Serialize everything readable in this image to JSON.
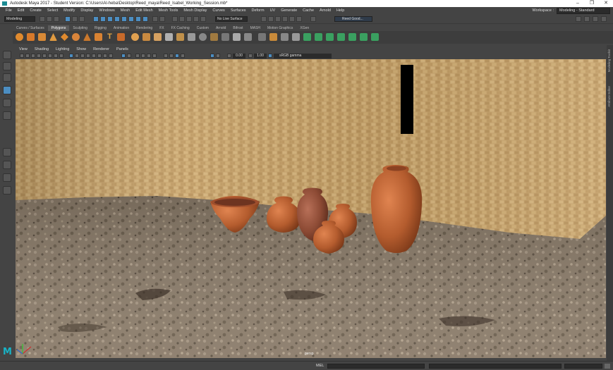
{
  "window": {
    "title": "Autodesk Maya 2017 - Student Version: C:\\Users\\Al-heba\\Desktop\\Reed_maya\\Reed_Isabel_Working_Session.mb*",
    "controls": [
      "–",
      "❐",
      "✕"
    ]
  },
  "menubar": {
    "items": [
      "File",
      "Edit",
      "Create",
      "Select",
      "Modify",
      "Display",
      "Windows",
      "Mesh",
      "Edit Mesh",
      "Mesh Tools",
      "Mesh Display",
      "Curves",
      "Surfaces",
      "Deform",
      "UV",
      "Generate",
      "Cache",
      "Arnold",
      "Help"
    ],
    "workspace_label": "Workspace :",
    "workspace_value": "Modeling - Standard"
  },
  "statusline": {
    "mode": "Modeling",
    "live_surface": "No Live Surface",
    "render_camera": "Reed Good..."
  },
  "shelf": {
    "tabs": [
      "Curves / Surfaces",
      "Polygons",
      "Sculpting",
      "Rigging",
      "Animation",
      "Rendering",
      "FX",
      "FX Caching",
      "Custom",
      "Arnold",
      "Bifrost",
      "MASH",
      "Motion Graphics",
      "XGen"
    ],
    "active_tab": "Polygons"
  },
  "viewport": {
    "menu": [
      "View",
      "Shading",
      "Lighting",
      "Show",
      "Renderer",
      "Panels"
    ],
    "near_value": "0.00",
    "far_value": "1.00",
    "color_space": "sRGB gamma",
    "camera_label": "persp"
  },
  "right_panel": {
    "tabs": [
      "Modeling Toolkit",
      "Attribute Editor"
    ]
  },
  "cmdline": {
    "label": "MEL"
  },
  "colors": {
    "accent": "#4c8ec2",
    "maya_logo": "#18b3c6",
    "wall": "#cba76f",
    "ground": "#8a7a68",
    "pottery": "#b45c2e"
  }
}
